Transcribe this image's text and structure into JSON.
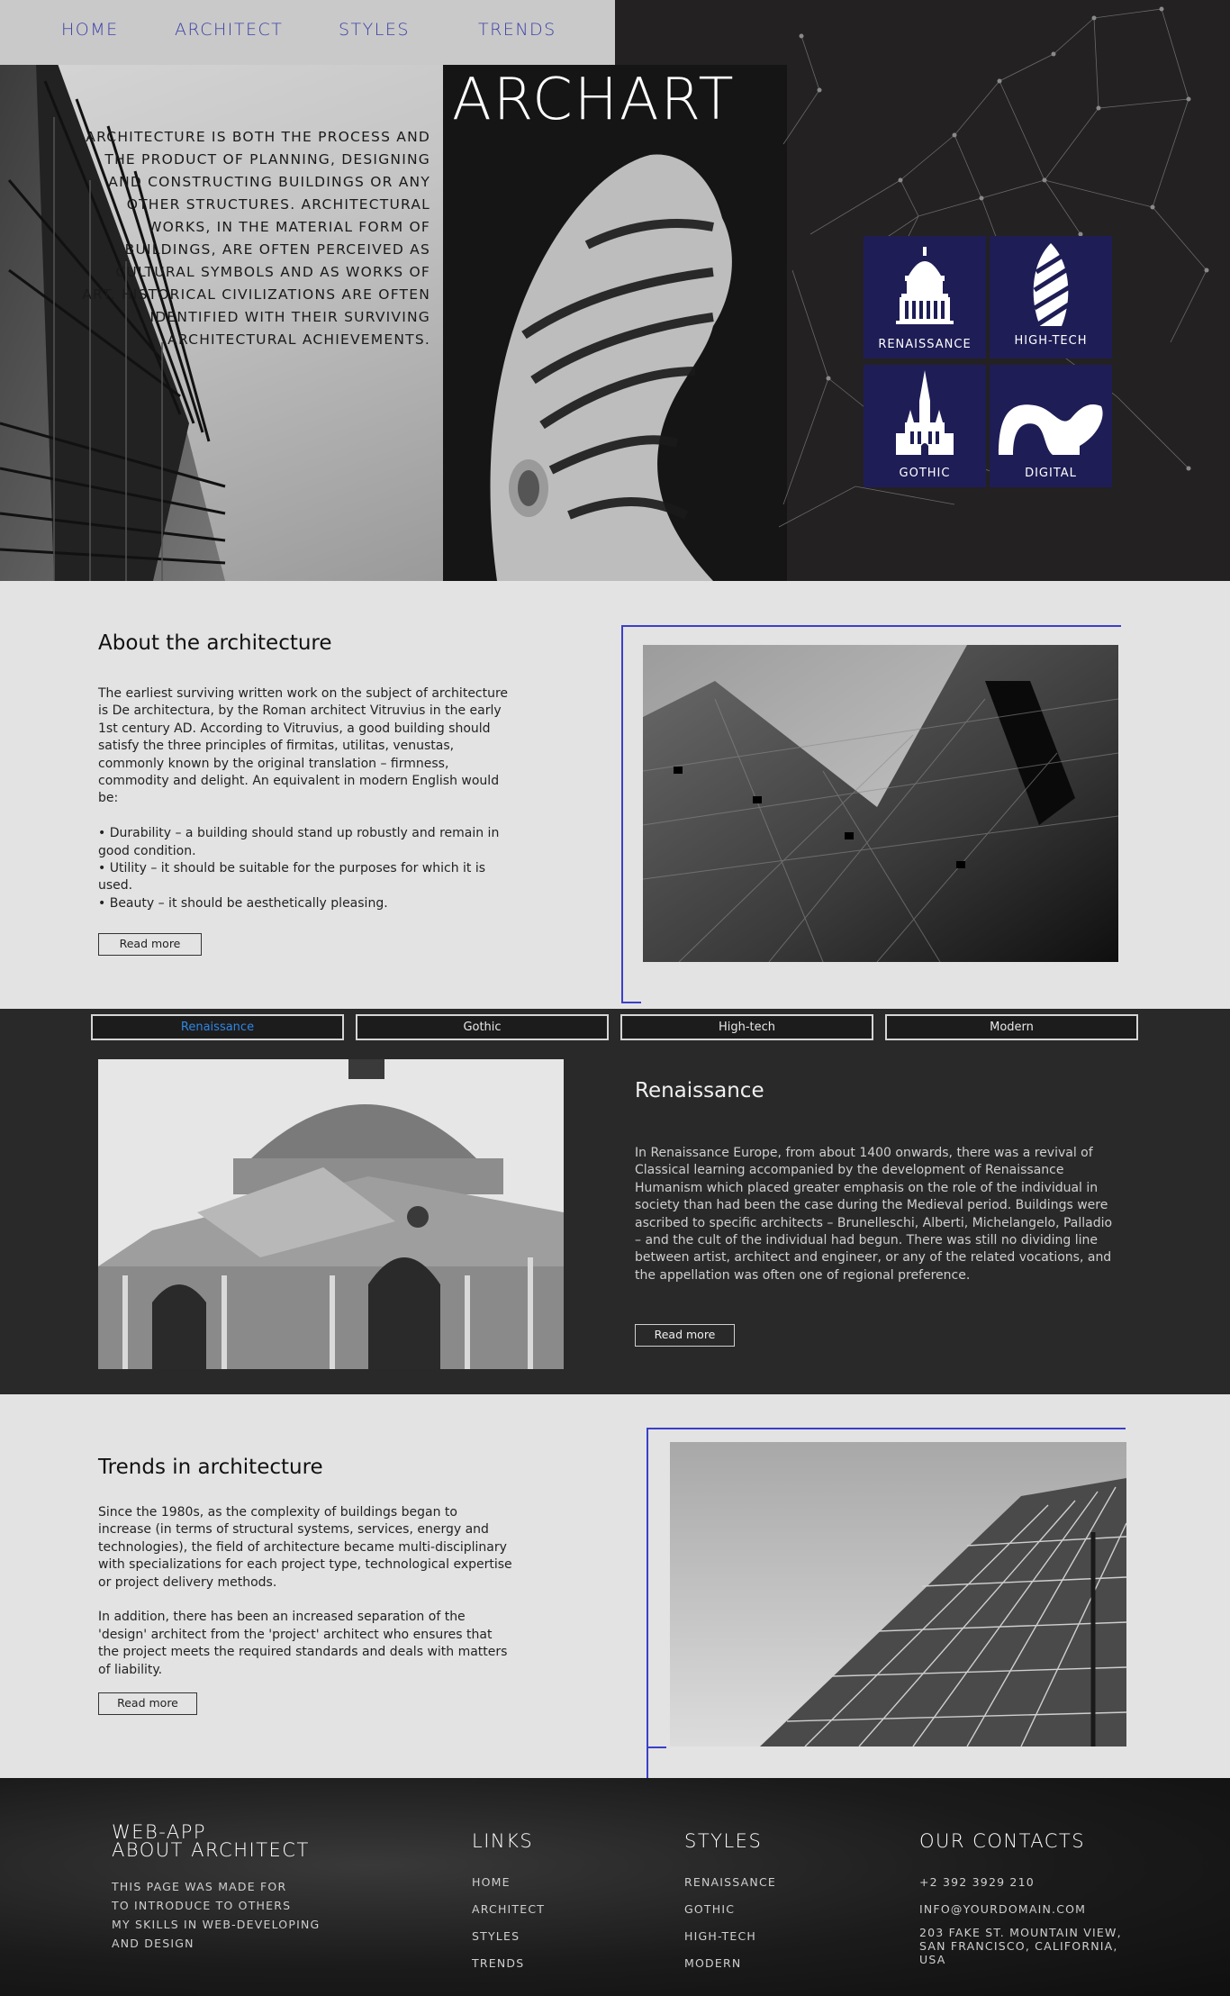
{
  "nav": {
    "items": [
      {
        "label": "HOME"
      },
      {
        "label": "ARCHITECT"
      },
      {
        "label": "STYLES"
      },
      {
        "label": "TRENDS"
      }
    ]
  },
  "hero": {
    "logo": "ARCHART",
    "intro": "ARCHITECTURE IS BOTH THE PROCESS AND THE PRODUCT OF PLANNING, DESIGNING AND CONSTRUCTING BUILDINGS OR ANY OTHER STRUCTURES. ARCHITECTURAL WORKS, IN THE MATERIAL FORM OF BUILDINGS, ARE OFTEN PERCEIVED AS CULTURAL SYMBOLS AND AS WORKS OF ART. HISTORICAL CIVILIZATIONS ARE OFTEN IDENTIFIED WITH THEIR SURVIVING ARCHITECTURAL ACHIEVEMENTS.",
    "tiles": [
      {
        "label": "RENAISSANCE",
        "icon": "dome-building-icon"
      },
      {
        "label": "HIGH-TECH",
        "icon": "gherkin-tower-icon"
      },
      {
        "label": "GOTHIC",
        "icon": "cathedral-icon"
      },
      {
        "label": "DIGITAL",
        "icon": "curved-building-icon"
      }
    ]
  },
  "about": {
    "title": "About the architecture",
    "body": "The earliest surviving written work on the subject of architecture is De architectura, by the Roman architect Vitruvius in the early 1st century AD. According to Vitruvius, a good building should satisfy the three principles of firmitas, utilitas, venustas, commonly known by the original translation – firmness, commodity and delight. An equivalent in modern English would be:\n\n• Durability – a building should stand up robustly and remain in good condition.\n• Utility – it should be suitable for the purposes for which it is used.\n• Beauty – it should be aesthetically pleasing.",
    "button": "Read more"
  },
  "styles": {
    "tabs": [
      {
        "label": "Renaissance",
        "active": true
      },
      {
        "label": "Gothic",
        "active": false
      },
      {
        "label": "High-tech",
        "active": false
      },
      {
        "label": "Modern",
        "active": false
      }
    ],
    "title": "Renaissance",
    "body": "In Renaissance Europe, from about 1400 onwards, there was a revival of Classical learning accompanied by the development of Renaissance Humanism which placed greater emphasis on the role of the individual in society than had been the case during the Medieval period. Buildings were ascribed to specific architects – Brunelleschi, Alberti, Michelangelo, Palladio – and the cult of the individual had begun. There was still no dividing line between artist, architect and engineer, or any of the related vocations, and the appellation was often one of regional preference.",
    "button": "Read more"
  },
  "trends": {
    "title": "Trends in architecture",
    "body": "Since the 1980s, as the complexity of buildings began to increase (in terms of structural systems, services, energy and technologies), the field of architecture became multi-disciplinary with specializations for each project type, technological expertise or project delivery methods.\n\nIn addition, there has been an increased separation of the 'design' architect from the 'project' architect who ensures that the project meets the required standards and deals with matters of liability.",
    "button": "Read more"
  },
  "footer": {
    "about_title_1": "WEB-APP",
    "about_title_2": "ABOUT ARCHITECT",
    "about_text": "THIS PAGE WAS MADE FOR\nTO INTRODUCE TO OTHERS\nMY SKILLS IN WEB-DEVELOPING\nAND DESIGN",
    "links_title": "LINKS",
    "links": [
      "HOME",
      "ARCHITECT",
      "STYLES",
      "TRENDS"
    ],
    "styles_title": "STYLES",
    "styles": [
      "RENAISSANCE",
      "GOTHIC",
      "HIGH-TECH",
      "MODERN"
    ],
    "contacts_title": "OUR CONTACTS",
    "phone": "+2 392 3929 210",
    "email": "INFO@YOURDOMAIN.COM",
    "address": "203 FAKE ST. MOUNTAIN VIEW,\nSAN FRANCISCO, CALIFORNIA,\nUSA"
  },
  "colors": {
    "accent_blue": "#3b3fc9",
    "tile_navy": "#1e1d56",
    "active_tab": "#2f86e3"
  }
}
